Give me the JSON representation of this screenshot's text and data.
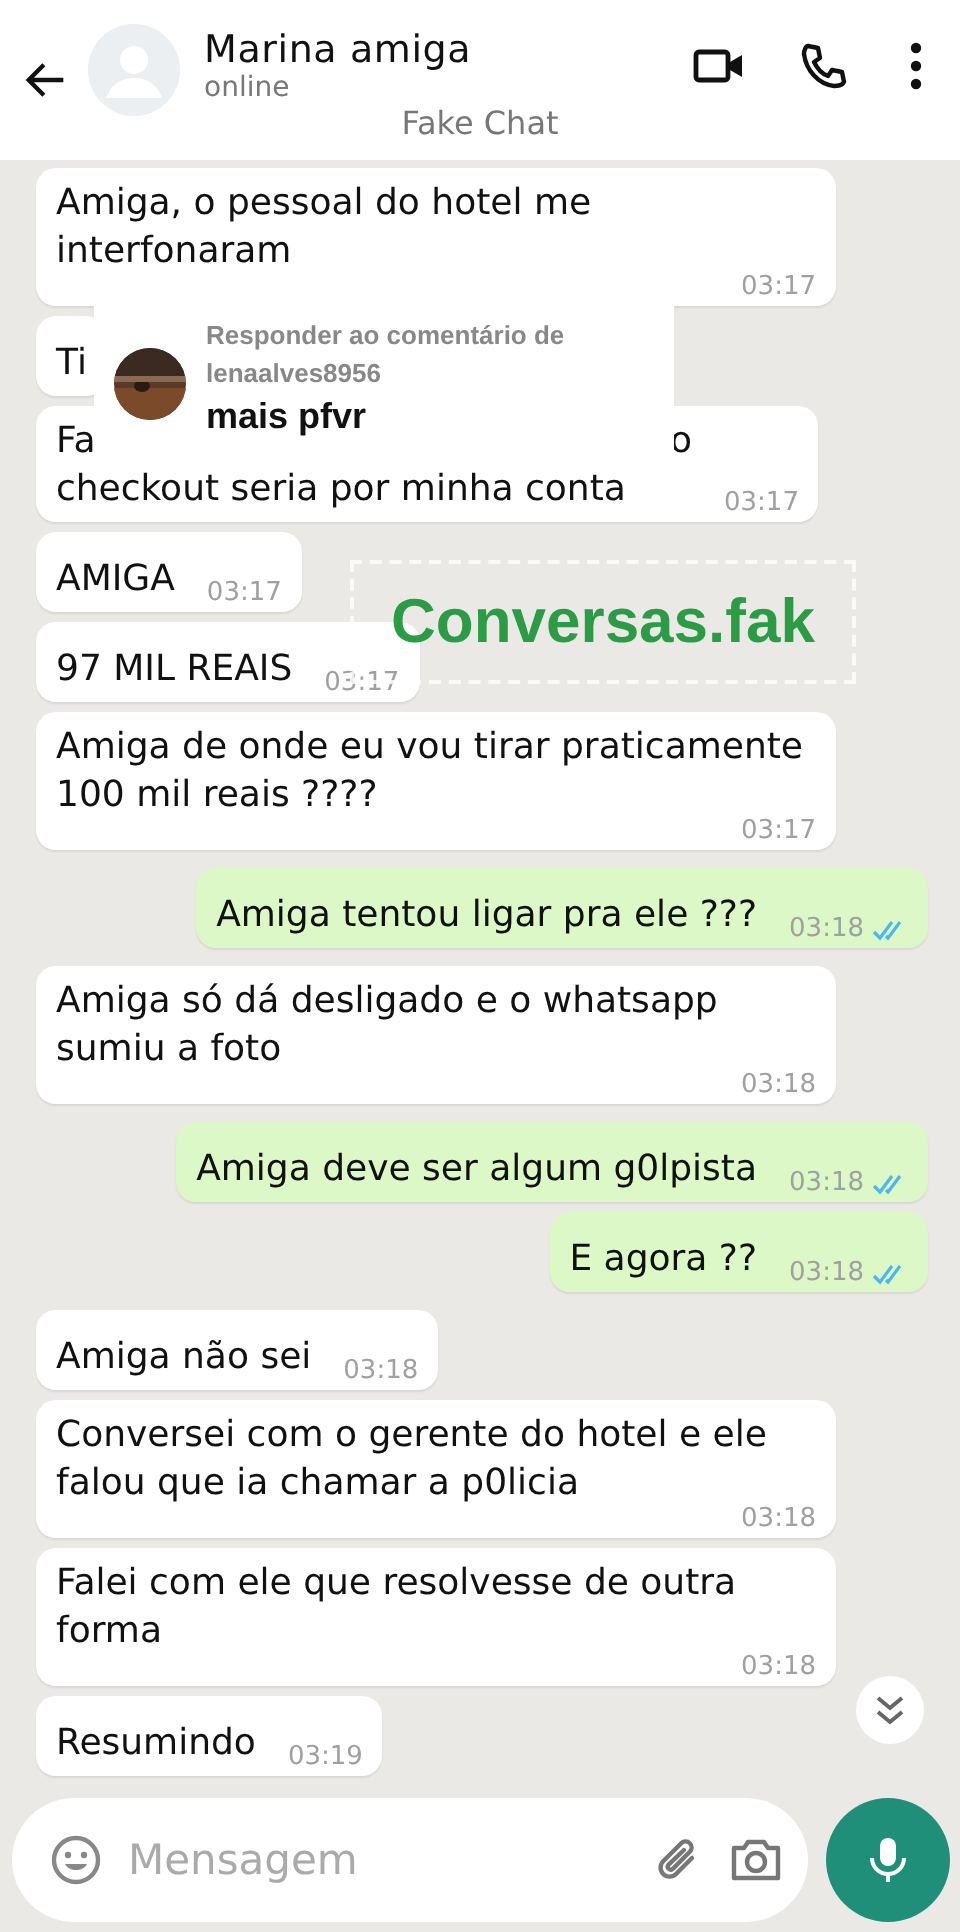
{
  "header": {
    "name": "Marina amiga",
    "status": "online",
    "overlay_label": "Fake Chat"
  },
  "messages": [
    {
      "kind": "in",
      "text": "Amiga, o pessoal do hotel me interfonaram",
      "time": "03:17"
    },
    {
      "kind": "in",
      "text": "Ti"
    },
    {
      "kind": "in",
      "covered_line": [
        "Fa",
        "o"
      ],
      "text": "checkout seria por minha conta",
      "time": "03:17"
    },
    {
      "kind": "in",
      "text": "AMIGA",
      "time": "03:17"
    },
    {
      "kind": "in",
      "text": "97 MIL REAIS",
      "time": "03:17"
    },
    {
      "kind": "in",
      "text": "Amiga de onde eu vou tirar praticamente 100 mil reais ????",
      "time": "03:17"
    },
    {
      "kind": "out",
      "text": "Amiga tentou ligar pra ele ???",
      "time": "03:18",
      "read": true
    },
    {
      "kind": "in",
      "text": "Amiga só dá desligado e o whatsapp sumiu a foto",
      "time": "03:18"
    },
    {
      "kind": "out",
      "text": "Amiga deve ser algum g0lpista",
      "time": "03:18",
      "read": true
    },
    {
      "kind": "out",
      "text": "E agora ??",
      "time": "03:18",
      "read": true
    },
    {
      "kind": "in",
      "text": "Amiga não sei",
      "time": "03:18"
    },
    {
      "kind": "in",
      "text": "Conversei com o gerente do hotel e ele falou que ia chamar a p0licia",
      "time": "03:18"
    },
    {
      "kind": "in",
      "text": "Falei com ele que resolvesse de outra forma",
      "time": "03:18"
    },
    {
      "kind": "in",
      "text": "Resumindo",
      "time": "03:19"
    }
  ],
  "reply_sticker": {
    "heading": "Responder ao comentário de",
    "username": "lenaalves8956",
    "comment": "mais pfvr"
  },
  "overlay_text": "Conversas.fak",
  "composer": {
    "placeholder": "Mensagem"
  }
}
